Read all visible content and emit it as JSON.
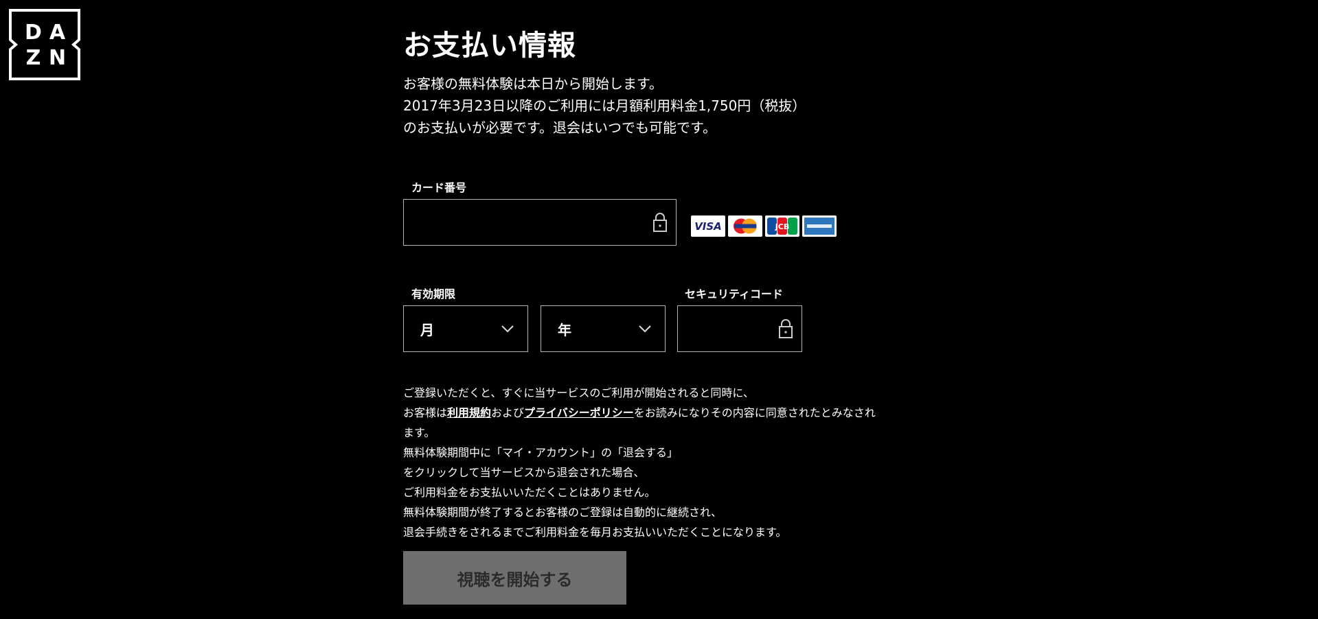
{
  "logo": {
    "letters": [
      "D",
      "A",
      "Z",
      "N"
    ]
  },
  "page": {
    "title": "お支払い情報",
    "intro_lines": [
      "お客様の無料体験は本日から開始します。",
      "2017年3月23日以降のご利用には月額利用料金1,750円（税抜）",
      "のお支払いが必要です。退会はいつでも可能です。"
    ]
  },
  "form": {
    "card_number_label": "カード番号",
    "card_number_value": "",
    "card_brands": [
      {
        "name": "VISA",
        "icon": "visa-logo"
      },
      {
        "name": "MasterCard",
        "icon": "mastercard-logo"
      },
      {
        "name": "JCB",
        "icon": "jcb-logo"
      },
      {
        "name": "AMERICAN EXPRESS",
        "icon": "amex-logo"
      }
    ],
    "expiry_label": "有効期限",
    "month_select": "月",
    "year_select": "年",
    "security_code_label": "セキュリティコード",
    "security_code_value": ""
  },
  "terms": {
    "line1": "ご登録いただくと、すぐに当サービスのご利用が開始されると同時に、",
    "line2_prefix": "お客様は",
    "terms_link": "利用規約",
    "line2_middle": "および",
    "privacy_link": "プライバシーポリシー",
    "line2_suffix": "をお読みになりその内容に同意されたとみなされ",
    "line3": "ます。",
    "line4": "無料体験期間中に「マイ・アカウント」の「退会する」",
    "line5": "をクリックして当サービスから退会された場合、",
    "line6": "ご利用料金をお支払いいただくことはありません。",
    "line7": "無料体験期間が終了するとお客様のご登録は自動的に継続され、",
    "line8": "退会手続きをされるまでご利用料金を毎月お支払いいただくことになります。"
  },
  "actions": {
    "start_label": "視聴を開始する"
  },
  "colors": {
    "background": "#000000",
    "border": "#b5b5b5",
    "button_disabled": "#6f6f6f"
  }
}
